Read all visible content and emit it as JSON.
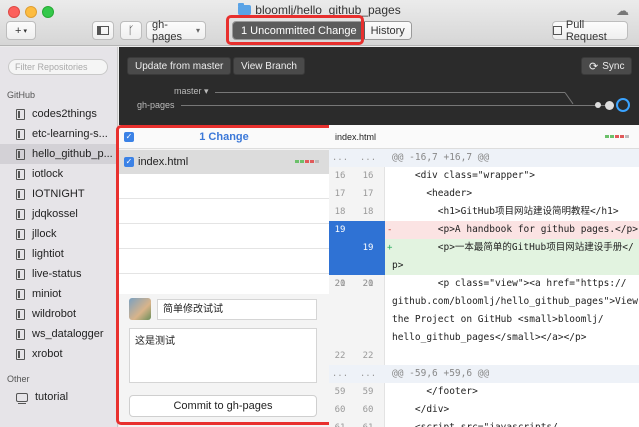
{
  "window": {
    "title": "bloomlj/hello_github_pages"
  },
  "toolbar": {
    "add_label": "+",
    "branch": "gh-pages",
    "tabs": [
      {
        "label": "1 Uncommitted Change",
        "active": true
      },
      {
        "label": "History",
        "active": false
      }
    ],
    "pull_request_label": "Pull Request"
  },
  "sidebar": {
    "filter_placeholder": "Filter Repositories",
    "groups": [
      {
        "label": "GitHub",
        "items": [
          "codes2things",
          "etc-learning-s...",
          "hello_github_p...",
          "iotlock",
          "IOTNIGHT",
          "jdqkossel",
          "jllock",
          "lightiot",
          "live-status",
          "miniot",
          "wildrobot",
          "ws_datalogger",
          "xrobot"
        ]
      },
      {
        "label": "Other",
        "items": [
          "tutorial"
        ]
      }
    ],
    "selected": "hello_github_p..."
  },
  "branch_area": {
    "update_label": "Update from master",
    "view_branch_label": "View Branch",
    "sync_label": "Sync",
    "master_label": "master ▾",
    "current_label": "gh-pages"
  },
  "changes": {
    "header": "1 Change",
    "files": [
      {
        "name": "index.html",
        "checked": true
      }
    ],
    "summary": "简单修改试试",
    "description": "这是测试",
    "commit_label": "Commit to gh-pages"
  },
  "diff": {
    "file": "index.html",
    "hunk1": {
      "old": "...",
      "new": "...",
      "text": "@@ -16,7 +16,7 @@"
    },
    "lines": [
      {
        "old": "16",
        "new": "16",
        "text": "    <div class=\"wrapper\">"
      },
      {
        "old": "17",
        "new": "17",
        "text": "      <header>"
      },
      {
        "old": "18",
        "new": "18",
        "text": "        <h1>GitHub项目网站建设简明教程</h1>"
      },
      {
        "old": "19",
        "new": "",
        "sign": "-",
        "text": "        <p>A handbook for github pages.</p>"
      },
      {
        "old": "",
        "new": "19",
        "sign": "+",
        "text": "        <p>一本最简单的GitHub项目网站建设手册</",
        "text2": "p>"
      },
      {
        "old": "20",
        "new": "20",
        "text": ""
      },
      {
        "old": "21",
        "new": "21",
        "text": "        <p class=\"view\"><a href=\"https://",
        "text2": "github.com/bloomlj/hello_github_pages\">View",
        "text3": "the Project on GitHub <small>bloomlj/",
        "text4": "hello_github_pages</small></a></p>"
      },
      {
        "old": "22",
        "new": "22",
        "text": ""
      }
    ],
    "hunk2": {
      "old": "...",
      "new": "...",
      "text": "@@ -59,6 +59,6 @@"
    },
    "lines2": [
      {
        "old": "59",
        "new": "59",
        "text": "      </footer>"
      },
      {
        "old": "60",
        "new": "60",
        "text": "    </div>"
      },
      {
        "old": "61",
        "new": "61",
        "text": "    <script src=\"javascripts/"
      }
    ]
  },
  "colors": {
    "accent": "#3b78d8",
    "highlight": "#e8302e",
    "deleted_bg": "#fbe3e3",
    "added_bg": "#e2f3e0"
  }
}
